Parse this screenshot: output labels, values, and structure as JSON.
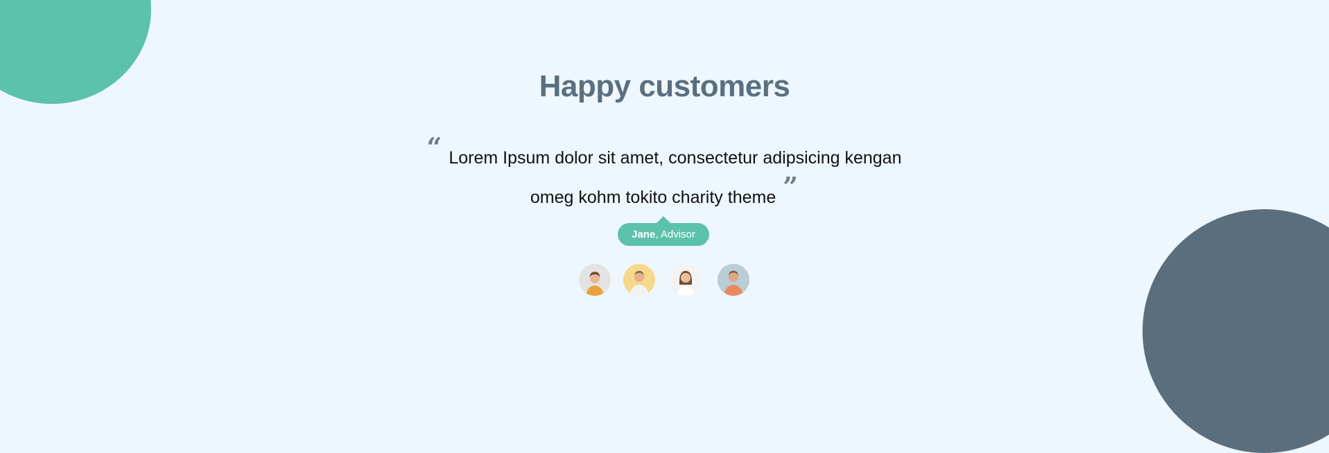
{
  "section": {
    "title": "Happy customers"
  },
  "testimonial": {
    "quote_line1": "Lorem Ipsum dolor sit amet, consectetur adipsicing kengan",
    "quote_line2": "omeg kohm tokito charity theme",
    "open_quote": "“",
    "close_quote": "”",
    "author_name": "Jane",
    "author_separator": ", ",
    "author_role": "Advisor"
  },
  "avatars": [
    {
      "id": "customer-1",
      "bg": "#e3e3e3",
      "shirt": "#e8a43a",
      "hair": "#6a4a36"
    },
    {
      "id": "customer-2",
      "bg": "#f6d98c",
      "shirt": "#f2f2f2",
      "hair": "#8b6a4a"
    },
    {
      "id": "customer-3",
      "bg": "#f3f3f3",
      "shirt": "#ffffff",
      "hair": "#7a4e35"
    },
    {
      "id": "customer-4",
      "bg": "#b9cdd5",
      "shirt": "#e88a5e",
      "hair": "#7b5a45"
    }
  ],
  "colors": {
    "background": "#eef7fd",
    "accent_green": "#5cc2ab",
    "accent_slate": "#5a6e7e",
    "title": "#5a6f80"
  }
}
